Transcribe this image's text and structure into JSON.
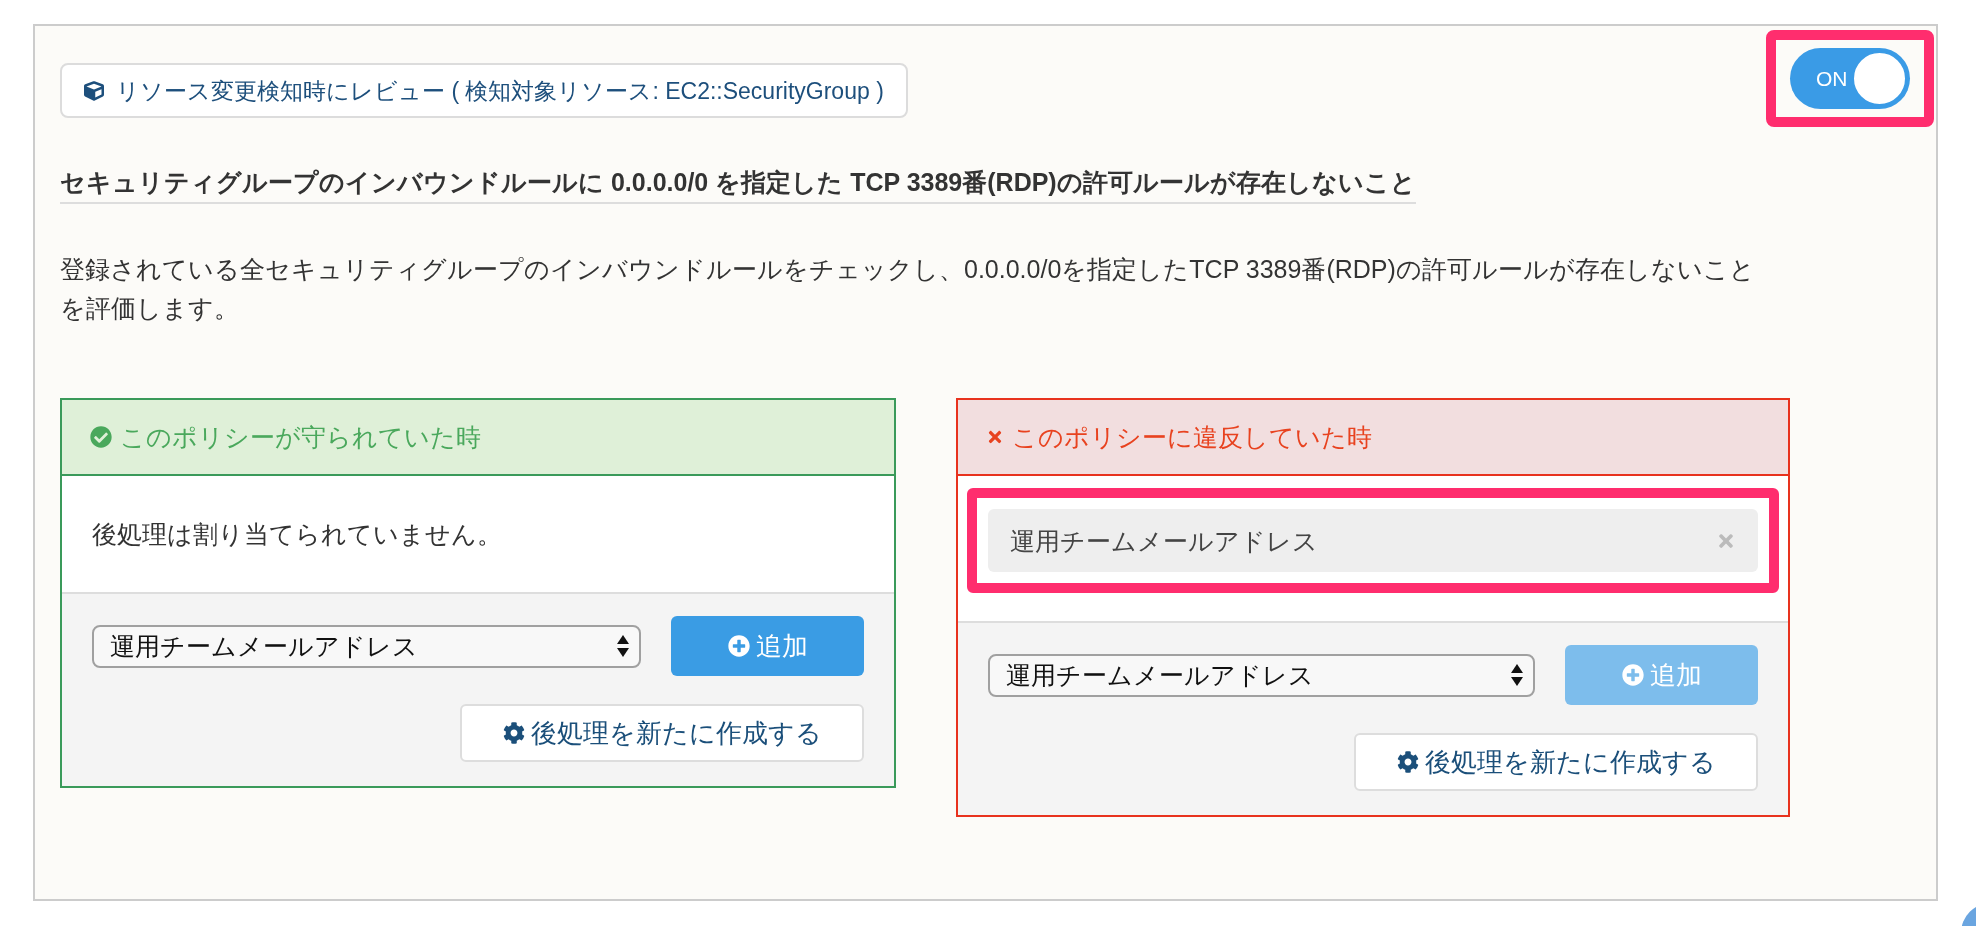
{
  "trigger_badge": {
    "text": "リソース変更検知時にレビュー ( 検知対象リソース: EC2::SecurityGroup )"
  },
  "toggle": {
    "label": "ON",
    "on": true,
    "highlighted": true
  },
  "policy": {
    "title": "セキュリティグループのインバウンドルールに 0.0.0.0/0 を指定した TCP 3389番(RDP)の許可ルールが存在しないこと",
    "description": "登録されている全セキュリティグループのインバウンドルールをチェックし、0.0.0.0/0を指定したTCP 3389番(RDP)の許可ルールが存在しないことを評価します。"
  },
  "panels": [
    {
      "kind": "compliant",
      "title": "このポリシーが守られていた時",
      "empty_message": "後処理は割り当てられていません。",
      "select": {
        "value": "運用チームメールアドレス"
      },
      "add_button": {
        "label": "追加",
        "disabled": false
      },
      "create_button": {
        "label": "後処理を新たに作成する"
      }
    },
    {
      "kind": "violation",
      "title": "このポリシーに違反していた時",
      "actions": [
        {
          "label": "運用チームメールアドレス",
          "highlighted": true
        }
      ],
      "select": {
        "value": "運用チームメールアドレス"
      },
      "add_button": {
        "label": "追加",
        "disabled": true
      },
      "create_button": {
        "label": "後処理を新たに作成する"
      }
    }
  ]
}
